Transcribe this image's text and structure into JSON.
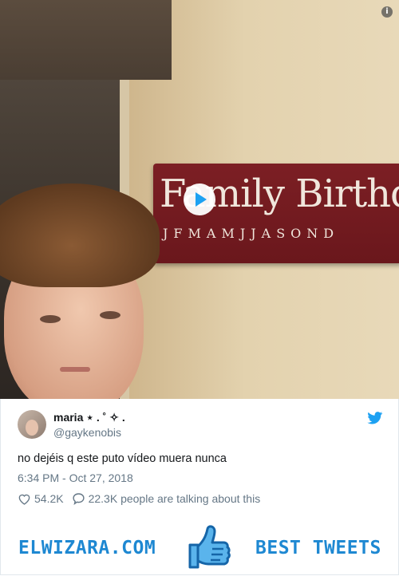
{
  "video": {
    "sign_title": "Family Birthdays",
    "sign_months": "JFMAMJJASOND"
  },
  "tweet": {
    "author_name": "maria ⋆ . ˚ ✧ .",
    "author_handle": "@gaykenobis",
    "text": "no dejéis q este puto vídeo muera nunca",
    "timestamp": "6:34 PM - Oct 27, 2018",
    "likes": "54.2K",
    "replies": "22.3K people are talking about this"
  },
  "banner": {
    "brand": "ELWIZARA.COM",
    "tagline": "BEST TWEETS"
  },
  "colors": {
    "accent": "#1da1f2",
    "brand": "#1e88d2",
    "muted": "#657786"
  },
  "icons": [
    "play-icon",
    "info-icon",
    "twitter-bird-icon",
    "heart-icon",
    "reply-icon",
    "thumbs-up-icon"
  ]
}
